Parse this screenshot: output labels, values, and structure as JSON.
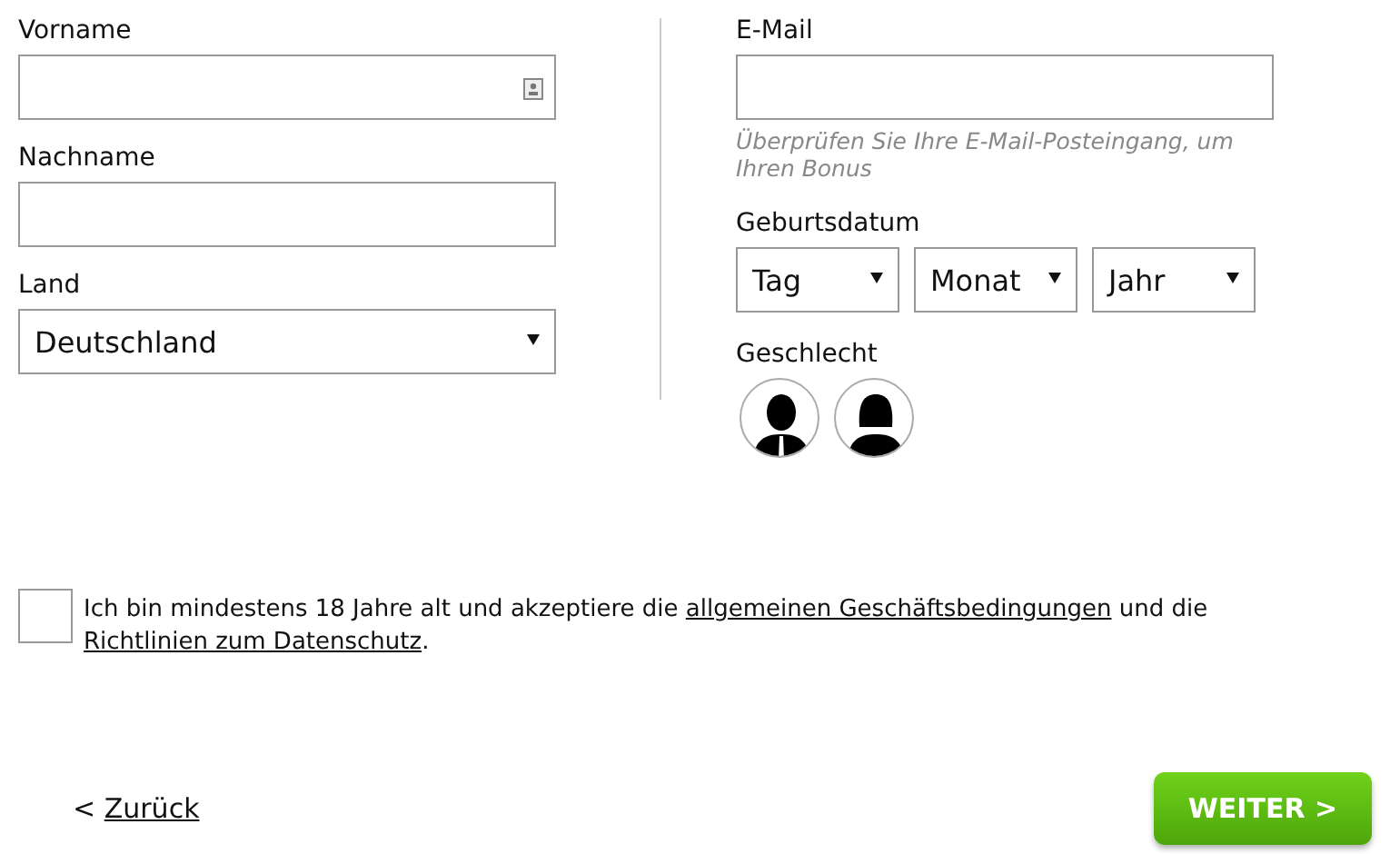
{
  "left_fields": [
    {
      "label": "Vorname",
      "kind": "text",
      "contact_icon": true
    },
    {
      "label": "Nachname",
      "kind": "text",
      "contact_icon": false
    },
    {
      "label": "Land",
      "kind": "select",
      "value": "Deutschland"
    }
  ],
  "email": {
    "label": "E-Mail",
    "hint": "Überprüfen Sie Ihre E-Mail-Posteingang, um Ihren Bonus"
  },
  "birthdate": {
    "label": "Geburtsdatum",
    "selects": [
      "Tag",
      "Monat",
      "Jahr"
    ]
  },
  "gender": {
    "label": "Geschlecht",
    "options": [
      {
        "kind": "male",
        "selected": false
      },
      {
        "kind": "female",
        "selected": false
      }
    ]
  },
  "terms": {
    "checked": false,
    "parts": [
      {
        "kind": "text",
        "text": "Ich bin mindestens 18 Jahre alt und akzeptiere die "
      },
      {
        "kind": "link",
        "text": "allgemeinen Geschäftsbedingungen"
      },
      {
        "kind": "text",
        "text": " und die "
      },
      {
        "kind": "link",
        "text": "Richtlinien zum Datenschutz"
      },
      {
        "kind": "text",
        "text": "."
      }
    ]
  },
  "back": {
    "prefix": "<",
    "label": "Zurück"
  },
  "next_button": "WEITER >"
}
